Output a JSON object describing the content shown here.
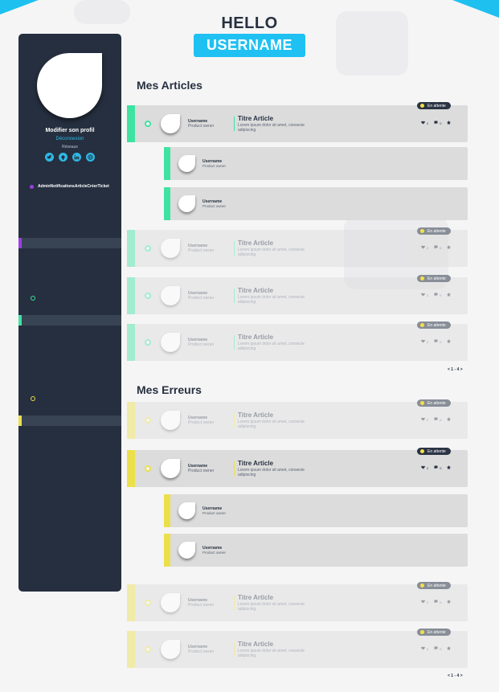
{
  "colors": {
    "accent": "#1ec0f0",
    "sidebar": "#252f3f",
    "articles": "#3fe3a1",
    "errors": "#ece04a",
    "purple": "#9b3fe0",
    "badge": "#2a3444"
  },
  "header": {
    "hello": "HELLO",
    "username": "USERNAME"
  },
  "sidebar": {
    "edit_profile": "Modifier son profil",
    "logout": "Déconnexion",
    "networks_label": "Réseaux",
    "social_icons": [
      "twitter-icon",
      "github-icon",
      "linkedin-icon",
      "globe-icon"
    ],
    "menu": "AdminNotificationsArticleCréerTicket"
  },
  "articles": {
    "title": "Mes Articles",
    "pager": "< 1 - 4 >",
    "cards": [
      {
        "username": "Username",
        "role": "Product owner",
        "title": "Titre Article",
        "desc": "Lorem ipsum dolor sit amet, consecte adipiscing",
        "likes": "2",
        "comments": "0",
        "badge": "En attente",
        "faded": false,
        "replies": [
          {
            "username": "Username",
            "role": "Product owner"
          },
          {
            "username": "Username",
            "role": "Product owner"
          }
        ]
      },
      {
        "username": "Username",
        "role": "Product owner",
        "title": "Titre Article",
        "desc": "Lorem ipsum dolor sit amet, consecte adipiscing",
        "likes": "2",
        "comments": "0",
        "badge": "En attente",
        "faded": true
      },
      {
        "username": "Username",
        "role": "Product owner",
        "title": "Titre Article",
        "desc": "Lorem ipsum dolor sit amet, consecte adipiscing",
        "likes": "2",
        "comments": "0",
        "badge": "En attente",
        "faded": true
      },
      {
        "username": "Username",
        "role": "Product owner",
        "title": "Titre Article",
        "desc": "Lorem ipsum dolor sit amet, consecte adipiscing",
        "likes": "2",
        "comments": "0",
        "badge": "En attente",
        "faded": true
      }
    ]
  },
  "errors": {
    "title": "Mes Erreurs",
    "pager": "< 1 - 4 >",
    "cards": [
      {
        "username": "Username",
        "role": "Product owner",
        "title": "Titre Article",
        "desc": "Lorem ipsum dolor sit amet, consecte adipiscing",
        "likes": "2",
        "comments": "0",
        "badge": "En attente",
        "faded": true
      },
      {
        "username": "Username",
        "role": "Product owner",
        "title": "Titre Article",
        "desc": "Lorem ipsum dolor sit amet, consecte adipiscing",
        "likes": "2",
        "comments": "0",
        "badge": "En attente",
        "faded": false,
        "replies": [
          {
            "username": "Username",
            "role": "Product owner"
          },
          {
            "username": "Username",
            "role": "Product owner"
          }
        ]
      },
      {
        "username": "Username",
        "role": "Product owner",
        "title": "Titre Article",
        "desc": "Lorem ipsum dolor sit amet, consecte adipiscing",
        "likes": "2",
        "comments": "0",
        "badge": "En attente",
        "faded": true
      },
      {
        "username": "Username",
        "role": "Product owner",
        "title": "Titre Article",
        "desc": "Lorem ipsum dolor sit amet, consecte adipiscing",
        "likes": "2",
        "comments": "0",
        "badge": "En attente",
        "faded": true
      }
    ]
  }
}
